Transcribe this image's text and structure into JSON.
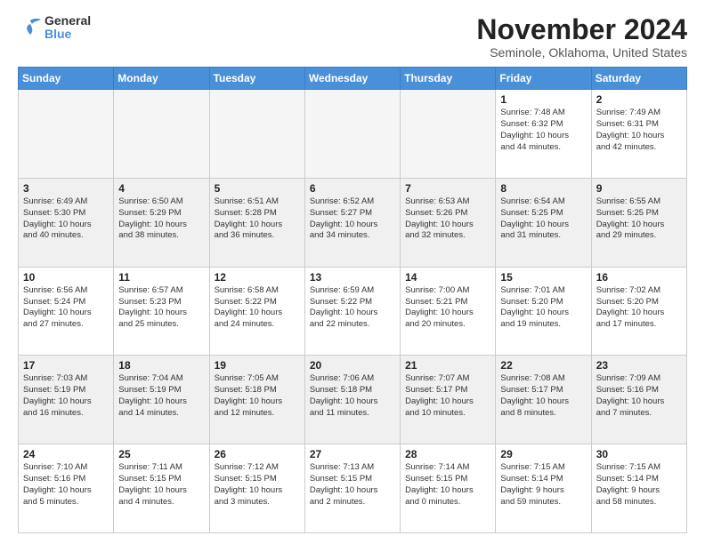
{
  "logo": {
    "line1": "General",
    "line2": "Blue"
  },
  "title": "November 2024",
  "location": "Seminole, Oklahoma, United States",
  "days_header": [
    "Sunday",
    "Monday",
    "Tuesday",
    "Wednesday",
    "Thursday",
    "Friday",
    "Saturday"
  ],
  "weeks": [
    [
      {
        "day": "",
        "info": ""
      },
      {
        "day": "",
        "info": ""
      },
      {
        "day": "",
        "info": ""
      },
      {
        "day": "",
        "info": ""
      },
      {
        "day": "",
        "info": ""
      },
      {
        "day": "1",
        "info": "Sunrise: 7:48 AM\nSunset: 6:32 PM\nDaylight: 10 hours\nand 44 minutes."
      },
      {
        "day": "2",
        "info": "Sunrise: 7:49 AM\nSunset: 6:31 PM\nDaylight: 10 hours\nand 42 minutes."
      }
    ],
    [
      {
        "day": "3",
        "info": "Sunrise: 6:49 AM\nSunset: 5:30 PM\nDaylight: 10 hours\nand 40 minutes."
      },
      {
        "day": "4",
        "info": "Sunrise: 6:50 AM\nSunset: 5:29 PM\nDaylight: 10 hours\nand 38 minutes."
      },
      {
        "day": "5",
        "info": "Sunrise: 6:51 AM\nSunset: 5:28 PM\nDaylight: 10 hours\nand 36 minutes."
      },
      {
        "day": "6",
        "info": "Sunrise: 6:52 AM\nSunset: 5:27 PM\nDaylight: 10 hours\nand 34 minutes."
      },
      {
        "day": "7",
        "info": "Sunrise: 6:53 AM\nSunset: 5:26 PM\nDaylight: 10 hours\nand 32 minutes."
      },
      {
        "day": "8",
        "info": "Sunrise: 6:54 AM\nSunset: 5:25 PM\nDaylight: 10 hours\nand 31 minutes."
      },
      {
        "day": "9",
        "info": "Sunrise: 6:55 AM\nSunset: 5:25 PM\nDaylight: 10 hours\nand 29 minutes."
      }
    ],
    [
      {
        "day": "10",
        "info": "Sunrise: 6:56 AM\nSunset: 5:24 PM\nDaylight: 10 hours\nand 27 minutes."
      },
      {
        "day": "11",
        "info": "Sunrise: 6:57 AM\nSunset: 5:23 PM\nDaylight: 10 hours\nand 25 minutes."
      },
      {
        "day": "12",
        "info": "Sunrise: 6:58 AM\nSunset: 5:22 PM\nDaylight: 10 hours\nand 24 minutes."
      },
      {
        "day": "13",
        "info": "Sunrise: 6:59 AM\nSunset: 5:22 PM\nDaylight: 10 hours\nand 22 minutes."
      },
      {
        "day": "14",
        "info": "Sunrise: 7:00 AM\nSunset: 5:21 PM\nDaylight: 10 hours\nand 20 minutes."
      },
      {
        "day": "15",
        "info": "Sunrise: 7:01 AM\nSunset: 5:20 PM\nDaylight: 10 hours\nand 19 minutes."
      },
      {
        "day": "16",
        "info": "Sunrise: 7:02 AM\nSunset: 5:20 PM\nDaylight: 10 hours\nand 17 minutes."
      }
    ],
    [
      {
        "day": "17",
        "info": "Sunrise: 7:03 AM\nSunset: 5:19 PM\nDaylight: 10 hours\nand 16 minutes."
      },
      {
        "day": "18",
        "info": "Sunrise: 7:04 AM\nSunset: 5:19 PM\nDaylight: 10 hours\nand 14 minutes."
      },
      {
        "day": "19",
        "info": "Sunrise: 7:05 AM\nSunset: 5:18 PM\nDaylight: 10 hours\nand 12 minutes."
      },
      {
        "day": "20",
        "info": "Sunrise: 7:06 AM\nSunset: 5:18 PM\nDaylight: 10 hours\nand 11 minutes."
      },
      {
        "day": "21",
        "info": "Sunrise: 7:07 AM\nSunset: 5:17 PM\nDaylight: 10 hours\nand 10 minutes."
      },
      {
        "day": "22",
        "info": "Sunrise: 7:08 AM\nSunset: 5:17 PM\nDaylight: 10 hours\nand 8 minutes."
      },
      {
        "day": "23",
        "info": "Sunrise: 7:09 AM\nSunset: 5:16 PM\nDaylight: 10 hours\nand 7 minutes."
      }
    ],
    [
      {
        "day": "24",
        "info": "Sunrise: 7:10 AM\nSunset: 5:16 PM\nDaylight: 10 hours\nand 5 minutes."
      },
      {
        "day": "25",
        "info": "Sunrise: 7:11 AM\nSunset: 5:15 PM\nDaylight: 10 hours\nand 4 minutes."
      },
      {
        "day": "26",
        "info": "Sunrise: 7:12 AM\nSunset: 5:15 PM\nDaylight: 10 hours\nand 3 minutes."
      },
      {
        "day": "27",
        "info": "Sunrise: 7:13 AM\nSunset: 5:15 PM\nDaylight: 10 hours\nand 2 minutes."
      },
      {
        "day": "28",
        "info": "Sunrise: 7:14 AM\nSunset: 5:15 PM\nDaylight: 10 hours\nand 0 minutes."
      },
      {
        "day": "29",
        "info": "Sunrise: 7:15 AM\nSunset: 5:14 PM\nDaylight: 9 hours\nand 59 minutes."
      },
      {
        "day": "30",
        "info": "Sunrise: 7:15 AM\nSunset: 5:14 PM\nDaylight: 9 hours\nand 58 minutes."
      }
    ]
  ]
}
